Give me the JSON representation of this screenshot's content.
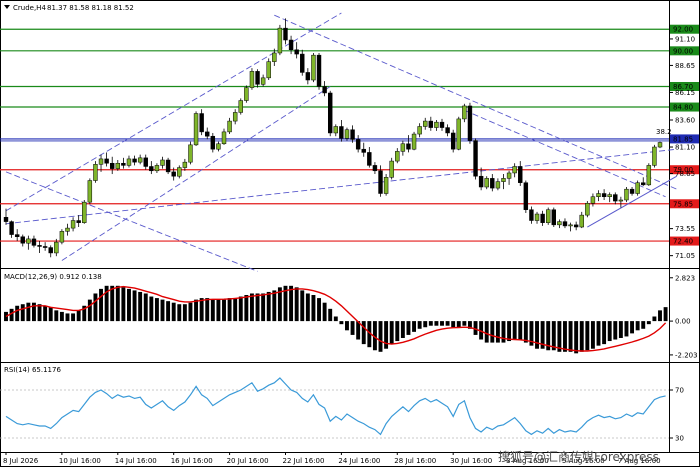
{
  "window": {
    "symbol_label": "Crude,H4",
    "ohlc_label": "81.37 81.58 81.18 81.52",
    "watermark": "搜狐号@汇商传媒Forexpress"
  },
  "colors": {
    "bull": "#7fb52a",
    "bear": "#000000",
    "hline_green": "#1a8a1a",
    "hline_red": "#e31b1b",
    "hline_blue": "#1f2bb3",
    "channel": "#5a5acc",
    "macd_signal": "#e00000",
    "macd_hist": "#000000",
    "rsi_line": "#3a9ad8"
  },
  "chart_data": [
    {
      "type": "candlestick",
      "title": "Crude,H4",
      "ylim": [
        70.0,
        93.5
      ],
      "price_ticks": [
        "91.10",
        "88.65",
        "86.15",
        "83.60",
        "81.10",
        "78.65",
        "73.55",
        "71.05"
      ],
      "x_tick_labels": [
        "8 Jul 2026",
        "10 Jul 16:00",
        "14 Jul 16:00",
        "16 Jul 16:00",
        "20 Jul 16:00",
        "22 Jul 16:00",
        "24 Jul 16:00",
        "28 Jul 16:00",
        "30 Jul 16:00",
        "3 Aug 16:00",
        "5 Aug 16:00",
        "7 Aug 16:00"
      ],
      "x_tick_index": [
        0,
        10,
        20,
        30,
        40,
        50,
        60,
        70,
        80,
        90,
        100,
        110
      ],
      "levels": [
        {
          "label": "92.00",
          "value": 92.0,
          "kind": "green"
        },
        {
          "label": "90.00",
          "value": 90.0,
          "kind": "green"
        },
        {
          "label": "86.70",
          "value": 86.7,
          "kind": "green"
        },
        {
          "label": "84.80",
          "value": 84.8,
          "kind": "green"
        },
        {
          "label": "81.85",
          "value": 81.85,
          "kind": "blue"
        },
        {
          "label": "79.00",
          "value": 79.0,
          "kind": "red"
        },
        {
          "label": "75.85",
          "value": 75.85,
          "kind": "red"
        },
        {
          "label": "72.40",
          "value": 72.4,
          "kind": "red"
        }
      ],
      "annotation_text": "38.2",
      "candles": [
        [
          74.6,
          75.4,
          73.9,
          74.2
        ],
        [
          74.2,
          74.3,
          72.7,
          73.0
        ],
        [
          73.0,
          73.5,
          72.4,
          72.8
        ],
        [
          72.8,
          73.0,
          71.9,
          72.2
        ],
        [
          72.2,
          72.9,
          71.6,
          72.6
        ],
        [
          72.6,
          72.9,
          71.8,
          72.0
        ],
        [
          72.0,
          72.4,
          71.3,
          71.9
        ],
        [
          71.9,
          72.3,
          71.5,
          71.8
        ],
        [
          71.8,
          72.0,
          70.9,
          71.3
        ],
        [
          71.3,
          72.6,
          71.0,
          72.3
        ],
        [
          72.3,
          73.5,
          72.1,
          73.3
        ],
        [
          73.3,
          74.0,
          72.9,
          73.6
        ],
        [
          73.6,
          74.6,
          73.3,
          74.3
        ],
        [
          74.3,
          74.8,
          73.7,
          74.1
        ],
        [
          74.1,
          76.2,
          74.0,
          76.0
        ],
        [
          76.0,
          78.2,
          75.8,
          78.0
        ],
        [
          78.0,
          79.8,
          77.8,
          79.5
        ],
        [
          79.5,
          80.4,
          78.8,
          80.0
        ],
        [
          80.0,
          80.6,
          79.3,
          79.6
        ],
        [
          79.6,
          80.2,
          78.6,
          79.1
        ],
        [
          79.1,
          79.9,
          78.9,
          79.6
        ],
        [
          79.6,
          80.1,
          79.1,
          79.4
        ],
        [
          79.4,
          80.3,
          79.2,
          80.0
        ],
        [
          80.0,
          80.3,
          79.4,
          79.7
        ],
        [
          79.7,
          80.4,
          79.5,
          80.1
        ],
        [
          80.1,
          80.4,
          79.0,
          79.3
        ],
        [
          79.3,
          79.8,
          78.6,
          78.9
        ],
        [
          78.9,
          79.6,
          78.7,
          79.4
        ],
        [
          79.4,
          80.2,
          79.1,
          79.9
        ],
        [
          79.9,
          80.1,
          78.6,
          78.8
        ],
        [
          78.8,
          79.2,
          78.0,
          78.4
        ],
        [
          78.4,
          79.4,
          78.2,
          79.2
        ],
        [
          79.2,
          80.0,
          78.9,
          79.7
        ],
        [
          79.7,
          81.6,
          79.5,
          81.3
        ],
        [
          81.3,
          84.4,
          81.2,
          84.2
        ],
        [
          84.2,
          84.6,
          82.2,
          82.5
        ],
        [
          82.5,
          82.9,
          81.8,
          82.1
        ],
        [
          82.1,
          82.4,
          80.6,
          80.9
        ],
        [
          80.9,
          81.6,
          80.7,
          81.4
        ],
        [
          81.4,
          82.8,
          81.3,
          82.5
        ],
        [
          82.5,
          83.8,
          82.3,
          83.5
        ],
        [
          83.5,
          84.6,
          83.2,
          84.3
        ],
        [
          84.3,
          85.6,
          84.1,
          85.4
        ],
        [
          85.4,
          86.8,
          85.2,
          86.6
        ],
        [
          86.6,
          88.4,
          86.4,
          88.1
        ],
        [
          88.1,
          88.3,
          86.6,
          86.9
        ],
        [
          86.9,
          87.8,
          86.7,
          87.5
        ],
        [
          87.5,
          89.3,
          87.3,
          89.0
        ],
        [
          89.0,
          90.2,
          88.6,
          89.8
        ],
        [
          89.8,
          92.4,
          89.6,
          92.1
        ],
        [
          92.1,
          93.0,
          90.6,
          91.0
        ],
        [
          91.0,
          91.4,
          89.7,
          90.1
        ],
        [
          90.1,
          90.8,
          89.3,
          89.7
        ],
        [
          89.7,
          90.1,
          87.7,
          88.0
        ],
        [
          88.0,
          88.4,
          86.9,
          87.3
        ],
        [
          87.3,
          89.8,
          87.1,
          89.6
        ],
        [
          89.6,
          89.8,
          86.4,
          86.7
        ],
        [
          86.7,
          87.2,
          85.8,
          86.1
        ],
        [
          86.1,
          86.3,
          82.1,
          82.4
        ],
        [
          82.4,
          83.2,
          82.1,
          83.0
        ],
        [
          83.0,
          83.6,
          81.6,
          81.9
        ],
        [
          81.9,
          82.9,
          81.7,
          82.7
        ],
        [
          82.7,
          83.1,
          81.5,
          81.8
        ],
        [
          81.8,
          82.2,
          80.6,
          80.9
        ],
        [
          80.9,
          81.5,
          80.2,
          80.6
        ],
        [
          80.6,
          81.1,
          79.2,
          79.4
        ],
        [
          79.4,
          79.7,
          78.6,
          78.9
        ],
        [
          78.9,
          79.4,
          76.5,
          76.8
        ],
        [
          76.8,
          78.6,
          76.6,
          78.3
        ],
        [
          78.3,
          80.1,
          78.1,
          79.8
        ],
        [
          79.8,
          81.0,
          79.6,
          80.7
        ],
        [
          80.7,
          81.7,
          80.3,
          81.4
        ],
        [
          81.4,
          82.2,
          80.6,
          80.9
        ],
        [
          80.9,
          82.5,
          80.8,
          82.3
        ],
        [
          82.3,
          83.3,
          82.0,
          83.0
        ],
        [
          83.0,
          83.8,
          82.7,
          83.5
        ],
        [
          83.5,
          83.9,
          82.6,
          82.9
        ],
        [
          82.9,
          83.6,
          82.6,
          83.4
        ],
        [
          83.4,
          83.7,
          82.6,
          82.9
        ],
        [
          82.9,
          83.2,
          82.1,
          82.4
        ],
        [
          82.4,
          82.7,
          80.6,
          80.9
        ],
        [
          80.9,
          83.9,
          80.8,
          83.7
        ],
        [
          83.7,
          85.1,
          83.4,
          84.9
        ],
        [
          84.9,
          85.2,
          81.4,
          81.7
        ],
        [
          81.7,
          81.9,
          78.1,
          78.4
        ],
        [
          78.4,
          79.2,
          77.1,
          77.4
        ],
        [
          77.4,
          78.4,
          77.2,
          78.2
        ],
        [
          78.2,
          78.6,
          77.0,
          77.3
        ],
        [
          77.3,
          78.2,
          77.1,
          77.9
        ],
        [
          77.9,
          78.6,
          77.2,
          78.2
        ],
        [
          78.2,
          78.9,
          77.6,
          78.7
        ],
        [
          78.7,
          79.6,
          78.3,
          79.3
        ],
        [
          79.3,
          79.8,
          77.5,
          77.8
        ],
        [
          77.8,
          78.0,
          75.0,
          75.3
        ],
        [
          75.3,
          75.6,
          74.0,
          74.3
        ],
        [
          74.3,
          75.1,
          74.0,
          74.9
        ],
        [
          74.9,
          75.2,
          73.8,
          74.1
        ],
        [
          74.1,
          75.5,
          73.9,
          75.3
        ],
        [
          75.3,
          75.5,
          73.7,
          73.9
        ],
        [
          73.9,
          74.4,
          73.6,
          74.2
        ],
        [
          74.2,
          74.5,
          73.6,
          73.8
        ],
        [
          73.8,
          74.1,
          73.3,
          73.9
        ],
        [
          73.9,
          74.2,
          73.4,
          73.7
        ],
        [
          73.7,
          75.1,
          73.6,
          74.8
        ],
        [
          74.8,
          76.1,
          74.6,
          75.9
        ],
        [
          75.9,
          76.8,
          75.6,
          76.5
        ],
        [
          76.5,
          77.1,
          76.1,
          76.8
        ],
        [
          76.8,
          77.2,
          76.2,
          76.5
        ],
        [
          76.5,
          76.9,
          76.0,
          76.7
        ],
        [
          76.7,
          76.9,
          75.8,
          76.1
        ],
        [
          76.1,
          76.5,
          75.5,
          76.2
        ],
        [
          76.2,
          77.4,
          76.0,
          77.2
        ],
        [
          77.2,
          77.4,
          76.6,
          76.8
        ],
        [
          76.8,
          78.0,
          76.6,
          77.8
        ],
        [
          77.8,
          78.3,
          77.5,
          77.6
        ],
        [
          77.6,
          79.6,
          77.5,
          79.4
        ],
        [
          79.4,
          81.3,
          79.2,
          81.1
        ],
        [
          81.1,
          81.6,
          81.0,
          81.52
        ]
      ]
    },
    {
      "type": "macd",
      "title": "MACD(12,26,9) 0.912 0.138",
      "ticks": [
        "2.823",
        "0.00",
        "-2.203"
      ],
      "ylim": [
        -2.6,
        3.2
      ],
      "histogram": [
        0.6,
        0.8,
        1.0,
        1.1,
        1.2,
        1.2,
        1.1,
        1.0,
        0.9,
        0.7,
        0.6,
        0.5,
        0.5,
        0.7,
        1.0,
        1.4,
        1.8,
        2.1,
        2.3,
        2.3,
        2.3,
        2.2,
        2.1,
        2.0,
        1.9,
        1.8,
        1.6,
        1.5,
        1.4,
        1.3,
        1.2,
        1.1,
        1.1,
        1.2,
        1.4,
        1.5,
        1.5,
        1.4,
        1.4,
        1.4,
        1.5,
        1.5,
        1.6,
        1.7,
        1.8,
        1.8,
        1.8,
        1.9,
        2.0,
        2.2,
        2.3,
        2.3,
        2.2,
        2.0,
        1.8,
        1.7,
        1.5,
        1.2,
        0.8,
        0.3,
        -0.2,
        -0.6,
        -0.9,
        -1.2,
        -1.5,
        -1.7,
        -1.9,
        -2.0,
        -1.8,
        -1.5,
        -1.3,
        -1.1,
        -0.9,
        -0.7,
        -0.5,
        -0.4,
        -0.3,
        -0.3,
        -0.3,
        -0.3,
        -0.4,
        -0.4,
        -0.3,
        -0.5,
        -0.9,
        -1.2,
        -1.4,
        -1.4,
        -1.4,
        -1.4,
        -1.3,
        -1.2,
        -1.2,
        -1.4,
        -1.6,
        -1.8,
        -1.8,
        -1.9,
        -1.9,
        -2.0,
        -2.0,
        -2.0,
        -2.1,
        -2.0,
        -1.9,
        -1.8,
        -1.6,
        -1.5,
        -1.3,
        -1.2,
        -1.1,
        -1.0,
        -0.8,
        -0.6,
        -0.5,
        -0.2,
        0.3,
        0.7,
        0.91
      ],
      "signal": [
        0.3,
        0.5,
        0.7,
        0.8,
        0.9,
        1.0,
        1.0,
        1.0,
        0.9,
        0.85,
        0.8,
        0.75,
        0.7,
        0.7,
        0.8,
        1.0,
        1.3,
        1.6,
        1.9,
        2.1,
        2.2,
        2.25,
        2.2,
        2.15,
        2.05,
        1.95,
        1.85,
        1.75,
        1.6,
        1.5,
        1.4,
        1.3,
        1.25,
        1.25,
        1.3,
        1.35,
        1.4,
        1.42,
        1.42,
        1.43,
        1.45,
        1.48,
        1.52,
        1.57,
        1.62,
        1.67,
        1.71,
        1.76,
        1.82,
        1.9,
        1.98,
        2.05,
        2.1,
        2.1,
        2.05,
        1.98,
        1.88,
        1.75,
        1.55,
        1.3,
        1.0,
        0.65,
        0.3,
        -0.05,
        -0.4,
        -0.75,
        -1.05,
        -1.3,
        -1.45,
        -1.5,
        -1.45,
        -1.38,
        -1.28,
        -1.15,
        -1.0,
        -0.85,
        -0.72,
        -0.6,
        -0.52,
        -0.46,
        -0.43,
        -0.42,
        -0.4,
        -0.42,
        -0.52,
        -0.66,
        -0.82,
        -0.95,
        -1.05,
        -1.13,
        -1.18,
        -1.2,
        -1.22,
        -1.26,
        -1.33,
        -1.42,
        -1.51,
        -1.6,
        -1.68,
        -1.76,
        -1.83,
        -1.88,
        -1.93,
        -1.95,
        -1.95,
        -1.92,
        -1.87,
        -1.81,
        -1.73,
        -1.64,
        -1.55,
        -1.46,
        -1.36,
        -1.25,
        -1.13,
        -0.98,
        -0.76,
        -0.48,
        -0.12
      ]
    },
    {
      "type": "line",
      "title": "RSI(14) 65.1176",
      "ticks": [
        "70",
        "30"
      ],
      "ylim": [
        20,
        90
      ],
      "values": [
        48,
        45,
        42,
        41,
        42,
        41,
        40,
        40,
        38,
        42,
        47,
        50,
        53,
        52,
        58,
        64,
        68,
        70,
        67,
        63,
        66,
        64,
        65,
        63,
        64,
        58,
        55,
        58,
        61,
        56,
        53,
        57,
        60,
        66,
        73,
        66,
        63,
        57,
        60,
        63,
        66,
        68,
        70,
        73,
        76,
        69,
        71,
        74,
        76,
        80,
        75,
        70,
        68,
        63,
        60,
        66,
        58,
        55,
        44,
        48,
        45,
        50,
        47,
        44,
        42,
        39,
        37,
        33,
        42,
        48,
        52,
        56,
        52,
        57,
        61,
        63,
        60,
        62,
        59,
        56,
        48,
        58,
        61,
        47,
        38,
        35,
        39,
        37,
        40,
        41,
        44,
        47,
        42,
        36,
        33,
        36,
        34,
        38,
        34,
        37,
        35,
        36,
        35,
        39,
        44,
        47,
        49,
        47,
        48,
        46,
        47,
        50,
        48,
        51,
        50,
        56,
        62,
        64,
        65.1
      ]
    }
  ]
}
